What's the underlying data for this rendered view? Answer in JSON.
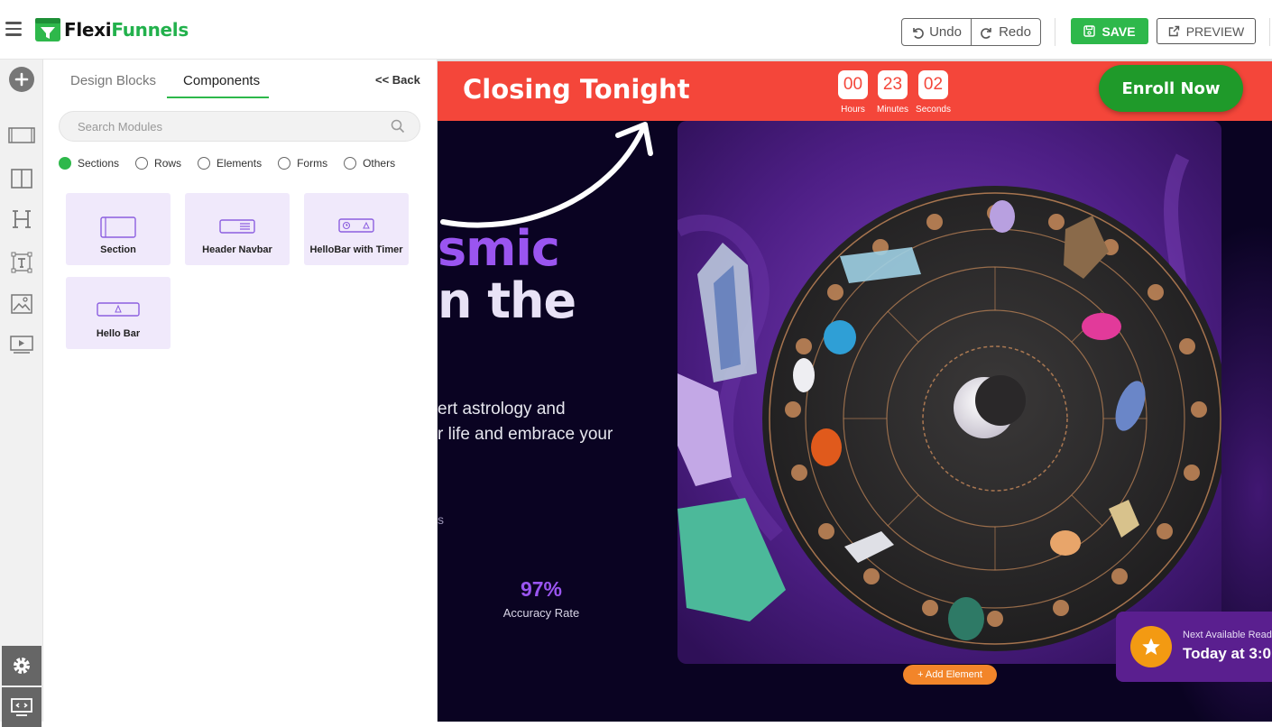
{
  "app": {
    "logo_text_dark": "Flexi",
    "logo_text_green": "Funnels",
    "brand_green": "#2eb84b"
  },
  "toolbar": {
    "undo_label": "Undo",
    "redo_label": "Redo",
    "save_label": "SAVE",
    "preview_label": "PREVIEW"
  },
  "rail": {
    "icons": [
      "add-icon",
      "section-icon",
      "columns-icon",
      "heading-icon",
      "text-icon",
      "image-icon",
      "video-icon",
      "settings-icon",
      "code-screen-icon"
    ]
  },
  "panel": {
    "tabs": [
      "Design Blocks",
      "Components"
    ],
    "active_tab": "Components",
    "back_label": "<< Back",
    "search_placeholder": "Search Modules",
    "filters": [
      "Sections",
      "Rows",
      "Elements",
      "Forms",
      "Others"
    ],
    "selected_filter": "Sections",
    "cards": [
      "Section",
      "Header Navbar",
      "HelloBar with Timer",
      "Hello Bar"
    ]
  },
  "canvas": {
    "hellobar_title": "Closing Tonight",
    "hellobar_color": "#f4463a",
    "timer": [
      {
        "value": "00",
        "label": "Hours"
      },
      {
        "value": "23",
        "label": "Minutes"
      },
      {
        "value": "02",
        "label": "Seconds"
      }
    ],
    "enroll_label": "Enroll Now",
    "hero_line1": "smic",
    "hero_line2": "n the",
    "sub_line1": "ert astrology and",
    "sub_line2": "r life and embrace your",
    "fragment": "s",
    "stat_value": "97%",
    "stat_label": "Accuracy Rate",
    "add_element_label": "+ Add Element",
    "reader_label": "Next Available Read",
    "reader_time": "Today at 3:0"
  }
}
